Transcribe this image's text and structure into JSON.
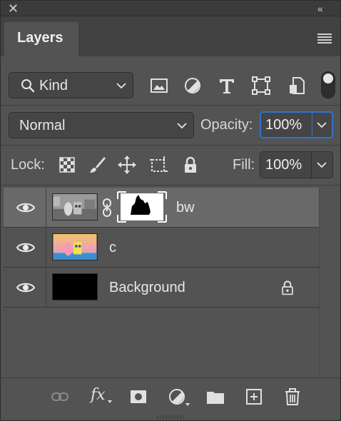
{
  "panel": {
    "tab_label": "Layers",
    "close_glyph": "✕",
    "collapse_glyph": "«"
  },
  "filter": {
    "kind_label": "Kind",
    "icons": [
      "pixel-layer-filter-icon",
      "adjustment-layer-filter-icon",
      "type-layer-filter-icon",
      "shape-layer-filter-icon",
      "smart-object-filter-icon"
    ],
    "filter_toggle": "on"
  },
  "blend": {
    "mode": "Normal",
    "opacity_label": "Opacity:",
    "opacity_value": "100%"
  },
  "lock": {
    "label": "Lock:",
    "icons": [
      "lock-transparent-pixels-icon",
      "lock-image-pixels-icon",
      "lock-position-icon",
      "lock-artboard-icon",
      "lock-all-icon"
    ],
    "fill_label": "Fill:",
    "fill_value": "100%"
  },
  "layers": [
    {
      "name": "bw",
      "selected": true,
      "visible": true,
      "has_mask": true,
      "locked": false
    },
    {
      "name": "c",
      "selected": false,
      "visible": true,
      "has_mask": false,
      "locked": false
    },
    {
      "name": "Background",
      "selected": false,
      "visible": true,
      "has_mask": false,
      "locked": true
    }
  ],
  "bottom_toolbar": {
    "fx_label": "fx",
    "icons": [
      "link-layers-icon",
      "add-layer-style-icon",
      "add-mask-icon",
      "new-fill-adjustment-icon",
      "new-group-icon",
      "new-layer-icon",
      "delete-layer-icon"
    ]
  },
  "colors": {
    "panel_bg": "#535353",
    "selected_row": "#696969",
    "focus_accent": "#2f73c8"
  }
}
